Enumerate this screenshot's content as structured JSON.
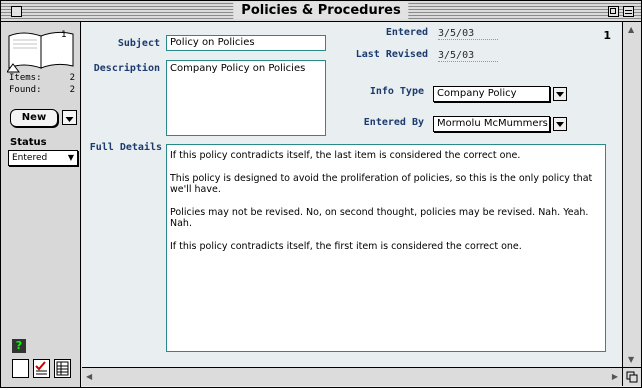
{
  "window": {
    "title": "Policies & Procedures"
  },
  "sidebar": {
    "record_number": "1",
    "items_label": "Items:",
    "items_count": "2",
    "found_label": "Found:",
    "found_count": "2",
    "new_label": "New",
    "status_label": "Status",
    "status_value": "Entered",
    "help_glyph": "?"
  },
  "form": {
    "record_indicator": "1",
    "entered_label": "Entered",
    "entered_value": "3/5/03",
    "last_revised_label": "Last Revised",
    "last_revised_value": "3/5/03",
    "subject_label": "Subject",
    "subject_value": "Policy on Policies",
    "description_label": "Description",
    "description_value": "Company Policy on Policies",
    "info_type_label": "Info Type",
    "info_type_value": "Company Policy",
    "entered_by_label": "Entered By",
    "entered_by_value": "Mormolu McMummers",
    "full_details_label": "Full Details",
    "full_details_paragraphs": [
      "If this policy contradicts itself, the last item is considered the correct one.",
      "This policy is designed to avoid the proliferation of policies, so this is the only policy that we'll have.",
      "Policies may not be revised.  No, on second thought, policies may be revised.  Nah.  Yeah.  Nah.",
      "If this policy contradicts itself, the first item is considered the correct one."
    ]
  },
  "colors": {
    "label": "#1c3a6e",
    "field_border": "#2a8a8a",
    "background": "#e9eff1"
  }
}
